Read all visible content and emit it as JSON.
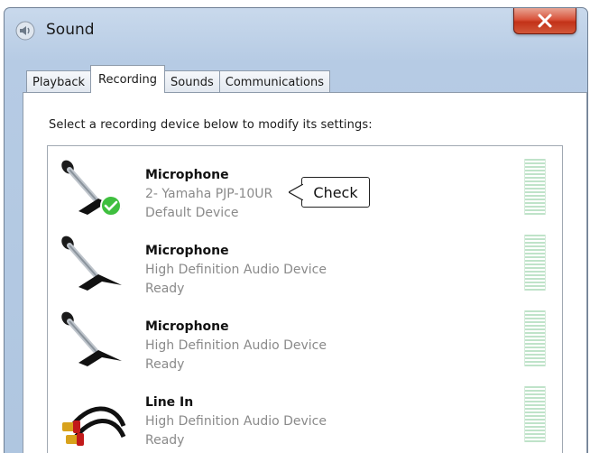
{
  "window": {
    "title": "Sound",
    "close_symbol": "x"
  },
  "tabs": [
    {
      "label": "Playback",
      "active": false
    },
    {
      "label": "Recording",
      "active": true
    },
    {
      "label": "Sounds",
      "active": false
    },
    {
      "label": "Communications",
      "active": false
    }
  ],
  "recording": {
    "instruction": "Select a recording device below to modify its settings:",
    "devices": [
      {
        "name": "Microphone",
        "description": "2- Yamaha PJP-10UR",
        "status": "Default Device",
        "icon": "microphone-icon",
        "is_default": true
      },
      {
        "name": "Microphone",
        "description": "High Definition Audio Device",
        "status": "Ready",
        "icon": "microphone-icon",
        "is_default": false
      },
      {
        "name": "Microphone",
        "description": "High Definition Audio Device",
        "status": "Ready",
        "icon": "microphone-icon",
        "is_default": false
      },
      {
        "name": "Line In",
        "description": "High Definition Audio Device",
        "status": "Ready",
        "icon": "rca-cable-icon",
        "is_default": false
      }
    ]
  },
  "annotation": {
    "callout_text": "Check"
  },
  "colors": {
    "default_check": "#3fbf3f",
    "close_button": "#c9402a",
    "meter": "#bfe3c9"
  }
}
